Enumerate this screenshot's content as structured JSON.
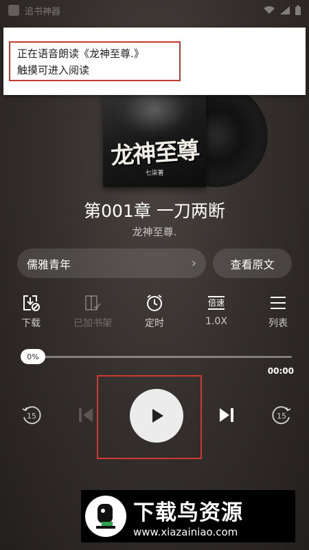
{
  "status_bar": {
    "app_name": "追书神器"
  },
  "notification": {
    "line1": "正在语音朗读《龙神至尊.》",
    "line2": "触摸可进入阅读"
  },
  "cover": {
    "title": "龙神至尊",
    "author": "七柒著"
  },
  "chapter": {
    "title": "第001章 一刀两断",
    "book": "龙神至尊."
  },
  "voice": {
    "name": "儒雅青年",
    "chevron": "›"
  },
  "original_button": "查看原文",
  "toolbar": [
    {
      "label": "下载",
      "icon": "download-icon",
      "enabled": true
    },
    {
      "label": "已加书架",
      "icon": "bookshelf-added-icon",
      "enabled": false
    },
    {
      "label": "定时",
      "icon": "alarm-clock-icon",
      "enabled": true
    },
    {
      "label": "1.0X",
      "icon": "speed-icon",
      "icon_text": "倍速",
      "enabled": true
    },
    {
      "label": "列表",
      "icon": "list-icon",
      "enabled": true
    }
  ],
  "progress": {
    "percent_label": "0%",
    "value": 0,
    "time": "00:00"
  },
  "controls": {
    "rewind_seconds": "15",
    "forward_seconds": "15"
  },
  "watermark": {
    "title": "下载鸟资源",
    "url": "www.xiazainiao.com"
  }
}
